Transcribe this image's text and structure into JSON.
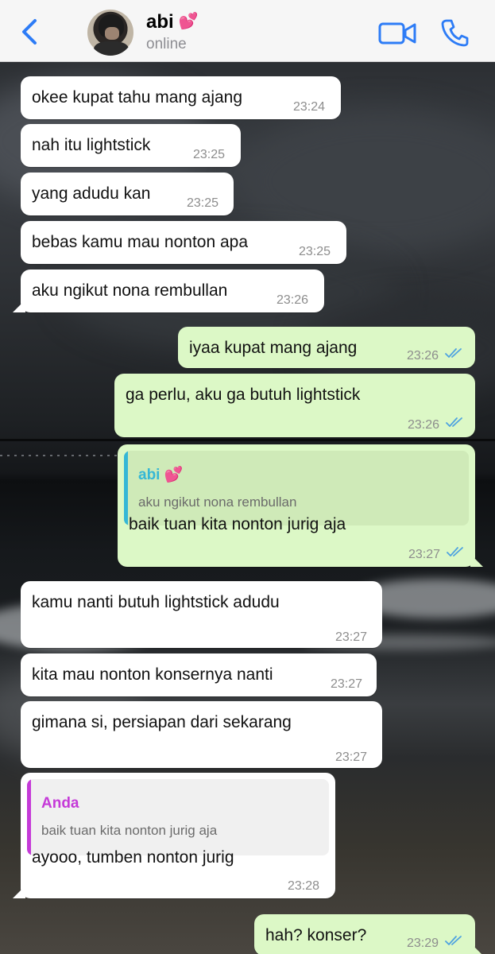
{
  "header": {
    "contact_name": "abi",
    "contact_emoji": "💕",
    "status": "online"
  },
  "colors": {
    "accent_blue": "#2d7cf6",
    "incoming_bubble": "#ffffff",
    "outgoing_bubble": "#dcf8c6",
    "read_ticks": "#4fa3e0",
    "quote_bar_contact": "#35b7d6",
    "quote_bar_self": "#c53ad8"
  },
  "messages": [
    {
      "direction": "in",
      "text": "okee kupat tahu mang ajang",
      "time": "23:24"
    },
    {
      "direction": "in",
      "text": "nah itu lightstick",
      "time": "23:25"
    },
    {
      "direction": "in",
      "text": "yang adudu kan",
      "time": "23:25"
    },
    {
      "direction": "in",
      "text": "bebas kamu mau nonton apa",
      "time": "23:25"
    },
    {
      "direction": "in",
      "text": "aku ngikut nona rembullan",
      "time": "23:26"
    },
    {
      "direction": "out",
      "text": "iyaa kupat mang ajang",
      "time": "23:26",
      "status": "read"
    },
    {
      "direction": "out",
      "text": "ga perlu, aku ga butuh lightstick",
      "time": "23:26",
      "status": "read"
    },
    {
      "direction": "out",
      "text": "baik tuan kita nonton jurig aja",
      "time": "23:27",
      "status": "read",
      "quote": {
        "name": "abi",
        "emoji": "💕",
        "text": "aku ngikut nona rembullan"
      }
    },
    {
      "direction": "in",
      "text": "kamu nanti butuh lightstick adudu",
      "time": "23:27"
    },
    {
      "direction": "in",
      "text": "kita mau nonton konsernya nanti",
      "time": "23:27"
    },
    {
      "direction": "in",
      "text": "gimana si, persiapan dari sekarang",
      "time": "23:27"
    },
    {
      "direction": "in",
      "text": "ayooo, tumben nonton jurig",
      "time": "23:28",
      "quote": {
        "name": "Anda",
        "text": "baik tuan kita nonton jurig aja"
      }
    },
    {
      "direction": "out",
      "text": "hah? konser?",
      "time": "23:29",
      "status": "read"
    }
  ]
}
